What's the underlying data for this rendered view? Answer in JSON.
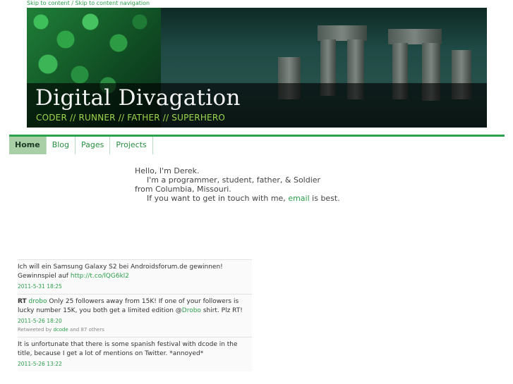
{
  "skip_links": {
    "content": "Skip to content",
    "separator": " / ",
    "navigation": "Skip to content navigation"
  },
  "header": {
    "title": "Digital Divagation",
    "tagline": "CODER // RUNNER // FATHER // SUPERHERO"
  },
  "nav": {
    "items": [
      {
        "label": "Home",
        "active": true
      },
      {
        "label": "Blog"
      },
      {
        "label": "Pages"
      },
      {
        "label": "Projects"
      }
    ]
  },
  "intro": {
    "line1": "Hello, I'm Derek.",
    "line2": "I'm a programmer, student, father, & Soldier",
    "line3": "from Columbia, Missouri.",
    "line4_before": "If you want to get in touch with me,",
    "line4_link": "email",
    "line4_after": "is best."
  },
  "tweets": [
    {
      "text": "Ich will ein Samsung Galaxy S2 bei Androidsforum.de gewinnen! Gewinnspiel auf",
      "link": "http://t.co/lQG6kl2",
      "time": "2011-5-31 18:25"
    },
    {
      "rt": "RT",
      "user": "drobo",
      "text_before": "Only 25 followers away from 15K! If one of your followers is lucky number 15K, you both get a limited edition @",
      "mention": "Drobo",
      "text_after": " shirt. Plz RT!",
      "time": "2011-5-26 18:20",
      "retweeted_prefix": "Retweeted by",
      "retweeted_user": "dcode",
      "retweeted_suffix": "and 87 others"
    },
    {
      "text": "It is unfortunate that there is some spanish festival with dcode in the title, because I get a lot of mentions on Twitter. *annoyed*",
      "time": "2011-5-26 13:22"
    }
  ],
  "colors": {
    "accent": "#2aa14b",
    "tagline": "#9bd84b",
    "nav_active_bg": "#a9cfa7"
  }
}
